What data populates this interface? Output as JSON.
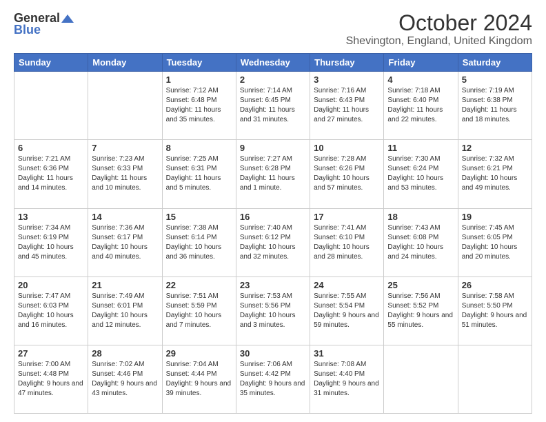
{
  "header": {
    "logo_general": "General",
    "logo_blue": "Blue",
    "month_title": "October 2024",
    "location": "Shevington, England, United Kingdom"
  },
  "weekdays": [
    "Sunday",
    "Monday",
    "Tuesday",
    "Wednesday",
    "Thursday",
    "Friday",
    "Saturday"
  ],
  "weeks": [
    [
      {
        "day": "",
        "sunrise": "",
        "sunset": "",
        "daylight": ""
      },
      {
        "day": "",
        "sunrise": "",
        "sunset": "",
        "daylight": ""
      },
      {
        "day": "1",
        "sunrise": "Sunrise: 7:12 AM",
        "sunset": "Sunset: 6:48 PM",
        "daylight": "Daylight: 11 hours and 35 minutes."
      },
      {
        "day": "2",
        "sunrise": "Sunrise: 7:14 AM",
        "sunset": "Sunset: 6:45 PM",
        "daylight": "Daylight: 11 hours and 31 minutes."
      },
      {
        "day": "3",
        "sunrise": "Sunrise: 7:16 AM",
        "sunset": "Sunset: 6:43 PM",
        "daylight": "Daylight: 11 hours and 27 minutes."
      },
      {
        "day": "4",
        "sunrise": "Sunrise: 7:18 AM",
        "sunset": "Sunset: 6:40 PM",
        "daylight": "Daylight: 11 hours and 22 minutes."
      },
      {
        "day": "5",
        "sunrise": "Sunrise: 7:19 AM",
        "sunset": "Sunset: 6:38 PM",
        "daylight": "Daylight: 11 hours and 18 minutes."
      }
    ],
    [
      {
        "day": "6",
        "sunrise": "Sunrise: 7:21 AM",
        "sunset": "Sunset: 6:36 PM",
        "daylight": "Daylight: 11 hours and 14 minutes."
      },
      {
        "day": "7",
        "sunrise": "Sunrise: 7:23 AM",
        "sunset": "Sunset: 6:33 PM",
        "daylight": "Daylight: 11 hours and 10 minutes."
      },
      {
        "day": "8",
        "sunrise": "Sunrise: 7:25 AM",
        "sunset": "Sunset: 6:31 PM",
        "daylight": "Daylight: 11 hours and 5 minutes."
      },
      {
        "day": "9",
        "sunrise": "Sunrise: 7:27 AM",
        "sunset": "Sunset: 6:28 PM",
        "daylight": "Daylight: 11 hours and 1 minute."
      },
      {
        "day": "10",
        "sunrise": "Sunrise: 7:28 AM",
        "sunset": "Sunset: 6:26 PM",
        "daylight": "Daylight: 10 hours and 57 minutes."
      },
      {
        "day": "11",
        "sunrise": "Sunrise: 7:30 AM",
        "sunset": "Sunset: 6:24 PM",
        "daylight": "Daylight: 10 hours and 53 minutes."
      },
      {
        "day": "12",
        "sunrise": "Sunrise: 7:32 AM",
        "sunset": "Sunset: 6:21 PM",
        "daylight": "Daylight: 10 hours and 49 minutes."
      }
    ],
    [
      {
        "day": "13",
        "sunrise": "Sunrise: 7:34 AM",
        "sunset": "Sunset: 6:19 PM",
        "daylight": "Daylight: 10 hours and 45 minutes."
      },
      {
        "day": "14",
        "sunrise": "Sunrise: 7:36 AM",
        "sunset": "Sunset: 6:17 PM",
        "daylight": "Daylight: 10 hours and 40 minutes."
      },
      {
        "day": "15",
        "sunrise": "Sunrise: 7:38 AM",
        "sunset": "Sunset: 6:14 PM",
        "daylight": "Daylight: 10 hours and 36 minutes."
      },
      {
        "day": "16",
        "sunrise": "Sunrise: 7:40 AM",
        "sunset": "Sunset: 6:12 PM",
        "daylight": "Daylight: 10 hours and 32 minutes."
      },
      {
        "day": "17",
        "sunrise": "Sunrise: 7:41 AM",
        "sunset": "Sunset: 6:10 PM",
        "daylight": "Daylight: 10 hours and 28 minutes."
      },
      {
        "day": "18",
        "sunrise": "Sunrise: 7:43 AM",
        "sunset": "Sunset: 6:08 PM",
        "daylight": "Daylight: 10 hours and 24 minutes."
      },
      {
        "day": "19",
        "sunrise": "Sunrise: 7:45 AM",
        "sunset": "Sunset: 6:05 PM",
        "daylight": "Daylight: 10 hours and 20 minutes."
      }
    ],
    [
      {
        "day": "20",
        "sunrise": "Sunrise: 7:47 AM",
        "sunset": "Sunset: 6:03 PM",
        "daylight": "Daylight: 10 hours and 16 minutes."
      },
      {
        "day": "21",
        "sunrise": "Sunrise: 7:49 AM",
        "sunset": "Sunset: 6:01 PM",
        "daylight": "Daylight: 10 hours and 12 minutes."
      },
      {
        "day": "22",
        "sunrise": "Sunrise: 7:51 AM",
        "sunset": "Sunset: 5:59 PM",
        "daylight": "Daylight: 10 hours and 7 minutes."
      },
      {
        "day": "23",
        "sunrise": "Sunrise: 7:53 AM",
        "sunset": "Sunset: 5:56 PM",
        "daylight": "Daylight: 10 hours and 3 minutes."
      },
      {
        "day": "24",
        "sunrise": "Sunrise: 7:55 AM",
        "sunset": "Sunset: 5:54 PM",
        "daylight": "Daylight: 9 hours and 59 minutes."
      },
      {
        "day": "25",
        "sunrise": "Sunrise: 7:56 AM",
        "sunset": "Sunset: 5:52 PM",
        "daylight": "Daylight: 9 hours and 55 minutes."
      },
      {
        "day": "26",
        "sunrise": "Sunrise: 7:58 AM",
        "sunset": "Sunset: 5:50 PM",
        "daylight": "Daylight: 9 hours and 51 minutes."
      }
    ],
    [
      {
        "day": "27",
        "sunrise": "Sunrise: 7:00 AM",
        "sunset": "Sunset: 4:48 PM",
        "daylight": "Daylight: 9 hours and 47 minutes."
      },
      {
        "day": "28",
        "sunrise": "Sunrise: 7:02 AM",
        "sunset": "Sunset: 4:46 PM",
        "daylight": "Daylight: 9 hours and 43 minutes."
      },
      {
        "day": "29",
        "sunrise": "Sunrise: 7:04 AM",
        "sunset": "Sunset: 4:44 PM",
        "daylight": "Daylight: 9 hours and 39 minutes."
      },
      {
        "day": "30",
        "sunrise": "Sunrise: 7:06 AM",
        "sunset": "Sunset: 4:42 PM",
        "daylight": "Daylight: 9 hours and 35 minutes."
      },
      {
        "day": "31",
        "sunrise": "Sunrise: 7:08 AM",
        "sunset": "Sunset: 4:40 PM",
        "daylight": "Daylight: 9 hours and 31 minutes."
      },
      {
        "day": "",
        "sunrise": "",
        "sunset": "",
        "daylight": ""
      },
      {
        "day": "",
        "sunrise": "",
        "sunset": "",
        "daylight": ""
      }
    ]
  ]
}
